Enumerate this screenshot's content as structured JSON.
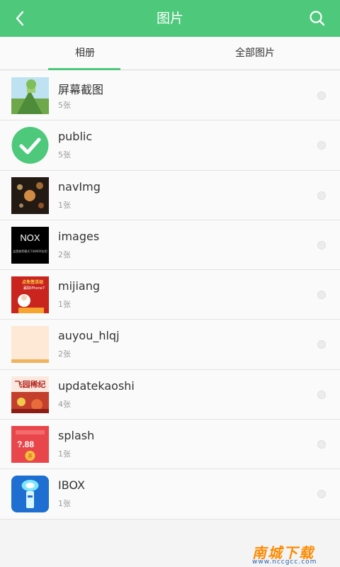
{
  "header": {
    "title": "图片",
    "back_icon": "chevron-left-icon",
    "search_icon": "search-icon",
    "bar_color": "#4ec97c"
  },
  "tabs": [
    {
      "label": "相册",
      "selected": true
    },
    {
      "label": "全部图片",
      "selected": false
    }
  ],
  "albums": [
    {
      "name": "屏幕截图",
      "count": "5张",
      "thumb": "landscape-thumbnail"
    },
    {
      "name": "public",
      "count": "5张",
      "thumb": "check-circle-icon"
    },
    {
      "name": "navImg",
      "count": "1张",
      "thumb": "bokeh-lights-thumbnail"
    },
    {
      "name": "images",
      "count": "2张",
      "thumb": "nox-banner-thumbnail",
      "thumb_text": "NOX",
      "thumb_subtext": "这是推荐模式下的NOX应用"
    },
    {
      "name": "mijiang",
      "count": "1张",
      "thumb": "red-promo-thumbnail",
      "thumb_text": "点免签活动",
      "thumb_subtext": "赢取iPhone7"
    },
    {
      "name": "auyou_hlqj",
      "count": "2张",
      "thumb": "peach-blank-thumbnail"
    },
    {
      "name": "updatekaoshi",
      "count": "4张",
      "thumb": "festival-banner-thumbnail",
      "thumb_text": "飞园稀纪"
    },
    {
      "name": "splash",
      "count": "1张",
      "thumb": "red-envelope-thumbnail",
      "thumb_text": "?.88",
      "thumb_subtext": "开"
    },
    {
      "name": "IBOX",
      "count": "1张",
      "thumb": "flashlight-app-icon"
    }
  ],
  "watermark": {
    "main": "南城下载",
    "url": "www.nccgcc.com"
  }
}
